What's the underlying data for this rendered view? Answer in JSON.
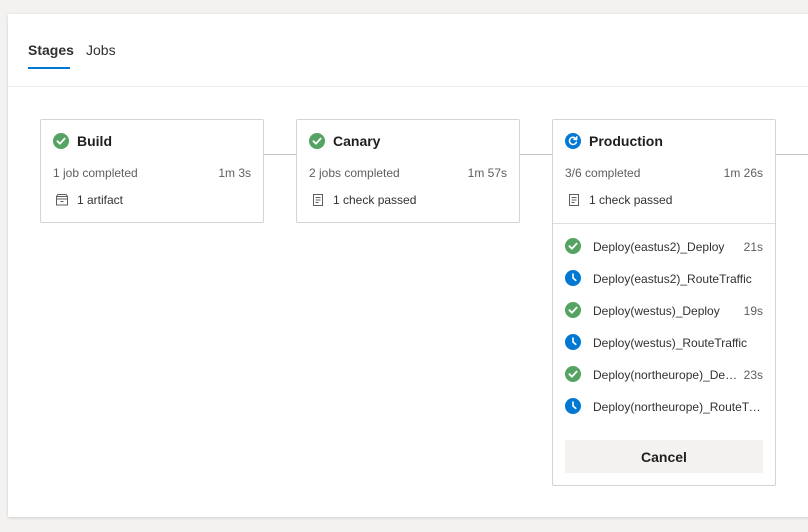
{
  "tabs": [
    {
      "label": "Stages",
      "active": true
    },
    {
      "label": "Jobs",
      "active": false
    }
  ],
  "stages": [
    {
      "name": "Build",
      "status": "succeeded",
      "meta": "1 job completed",
      "duration": "1m 3s",
      "sub_icon": "artifact-icon",
      "sub_text": "1 artifact"
    },
    {
      "name": "Canary",
      "status": "succeeded",
      "meta": "2 jobs completed",
      "duration": "1m 57s",
      "sub_icon": "checklist-icon",
      "sub_text": "1 check passed"
    },
    {
      "name": "Production",
      "status": "in-progress",
      "meta": "3/6 completed",
      "duration": "1m 26s",
      "sub_icon": "checklist-icon",
      "sub_text": "1 check passed",
      "jobs": [
        {
          "name": "Deploy(eastus2)_Deploy",
          "status": "succeeded",
          "duration": "21s"
        },
        {
          "name": "Deploy(eastus2)_RouteTraffic",
          "status": "waiting",
          "duration": ""
        },
        {
          "name": "Deploy(westus)_Deploy",
          "status": "succeeded",
          "duration": "19s"
        },
        {
          "name": "Deploy(westus)_RouteTraffic",
          "status": "waiting",
          "duration": ""
        },
        {
          "name": "Deploy(northeurope)_Deploy",
          "status": "succeeded",
          "duration": "23s"
        },
        {
          "name": "Deploy(northeurope)_RouteTraffic",
          "status": "waiting",
          "duration": ""
        }
      ],
      "cancel_label": "Cancel"
    }
  ],
  "colors": {
    "success": "#55a362",
    "running": "#0078d4",
    "accent": "#0078d4"
  }
}
